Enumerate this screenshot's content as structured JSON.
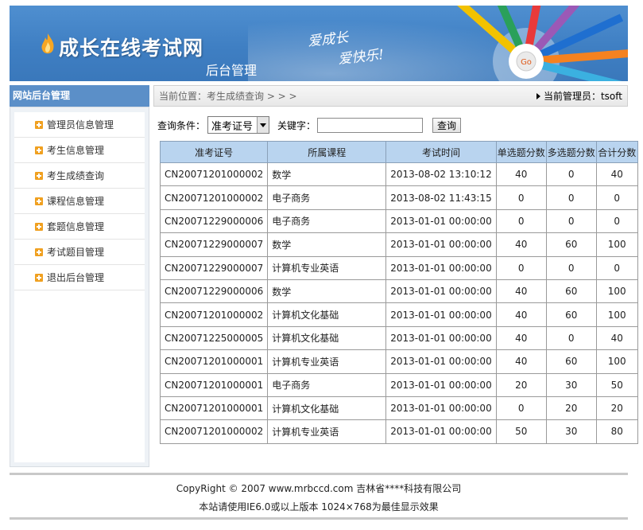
{
  "header": {
    "site_title": "成长在线考试网",
    "sub_title": "后台管理",
    "slogan_line1": "爱成长",
    "slogan_line2": "爱快乐!",
    "pencil_badge": "Go"
  },
  "sidebar": {
    "title": "网站后台管理",
    "items": [
      {
        "label": "管理员信息管理"
      },
      {
        "label": "考生信息管理"
      },
      {
        "label": "考生成绩查询"
      },
      {
        "label": "课程信息管理"
      },
      {
        "label": "套题信息管理"
      },
      {
        "label": "考试题目管理"
      },
      {
        "label": "退出后台管理"
      }
    ]
  },
  "location_bar": {
    "location": "当前位置：考生成绩查询 > > >",
    "admin": "当前管理员：tsoft"
  },
  "search": {
    "condition_label": "查询条件：",
    "condition_value": "准考证号",
    "keyword_label": "关键字：",
    "keyword_value": "",
    "button_label": "查询"
  },
  "table": {
    "headers": [
      "准考证号",
      "所属课程",
      "考试时间",
      "单选题分数",
      "多选题分数",
      "合计分数"
    ],
    "rows": [
      [
        "CN20071201000002",
        "数学",
        "2013-08-02 13:10:12",
        "40",
        "0",
        "40"
      ],
      [
        "CN20071201000002",
        "电子商务",
        "2013-08-02 11:43:15",
        "0",
        "0",
        "0"
      ],
      [
        "CN20071229000006",
        "电子商务",
        "2013-01-01 00:00:00",
        "0",
        "0",
        "0"
      ],
      [
        "CN20071229000007",
        "数学",
        "2013-01-01 00:00:00",
        "40",
        "60",
        "100"
      ],
      [
        "CN20071229000007",
        "计算机专业英语",
        "2013-01-01 00:00:00",
        "0",
        "0",
        "0"
      ],
      [
        "CN20071229000006",
        "数学",
        "2013-01-01 00:00:00",
        "40",
        "60",
        "100"
      ],
      [
        "CN20071201000002",
        "计算机文化基础",
        "2013-01-01 00:00:00",
        "40",
        "60",
        "100"
      ],
      [
        "CN20071225000005",
        "计算机文化基础",
        "2013-01-01 00:00:00",
        "40",
        "0",
        "40"
      ],
      [
        "CN20071201000001",
        "计算机专业英语",
        "2013-01-01 00:00:00",
        "40",
        "60",
        "100"
      ],
      [
        "CN20071201000001",
        "电子商务",
        "2013-01-01 00:00:00",
        "20",
        "30",
        "50"
      ],
      [
        "CN20071201000001",
        "计算机文化基础",
        "2013-01-01 00:00:00",
        "0",
        "20",
        "20"
      ],
      [
        "CN20071201000002",
        "计算机专业英语",
        "2013-01-01 00:00:00",
        "50",
        "30",
        "80"
      ]
    ]
  },
  "footer": {
    "copyright": "CopyRight © 2007 www.mrbccd.com 吉林省****科技有限公司",
    "notice": "本站请使用IE6.0或以上版本 1024×768为最佳显示效果"
  },
  "colors": {
    "banner_blue": "#4a87c9",
    "sidebar_header": "#5b8fc8",
    "table_header": "#b9d4ef",
    "menu_bullet": "#f0a020"
  }
}
